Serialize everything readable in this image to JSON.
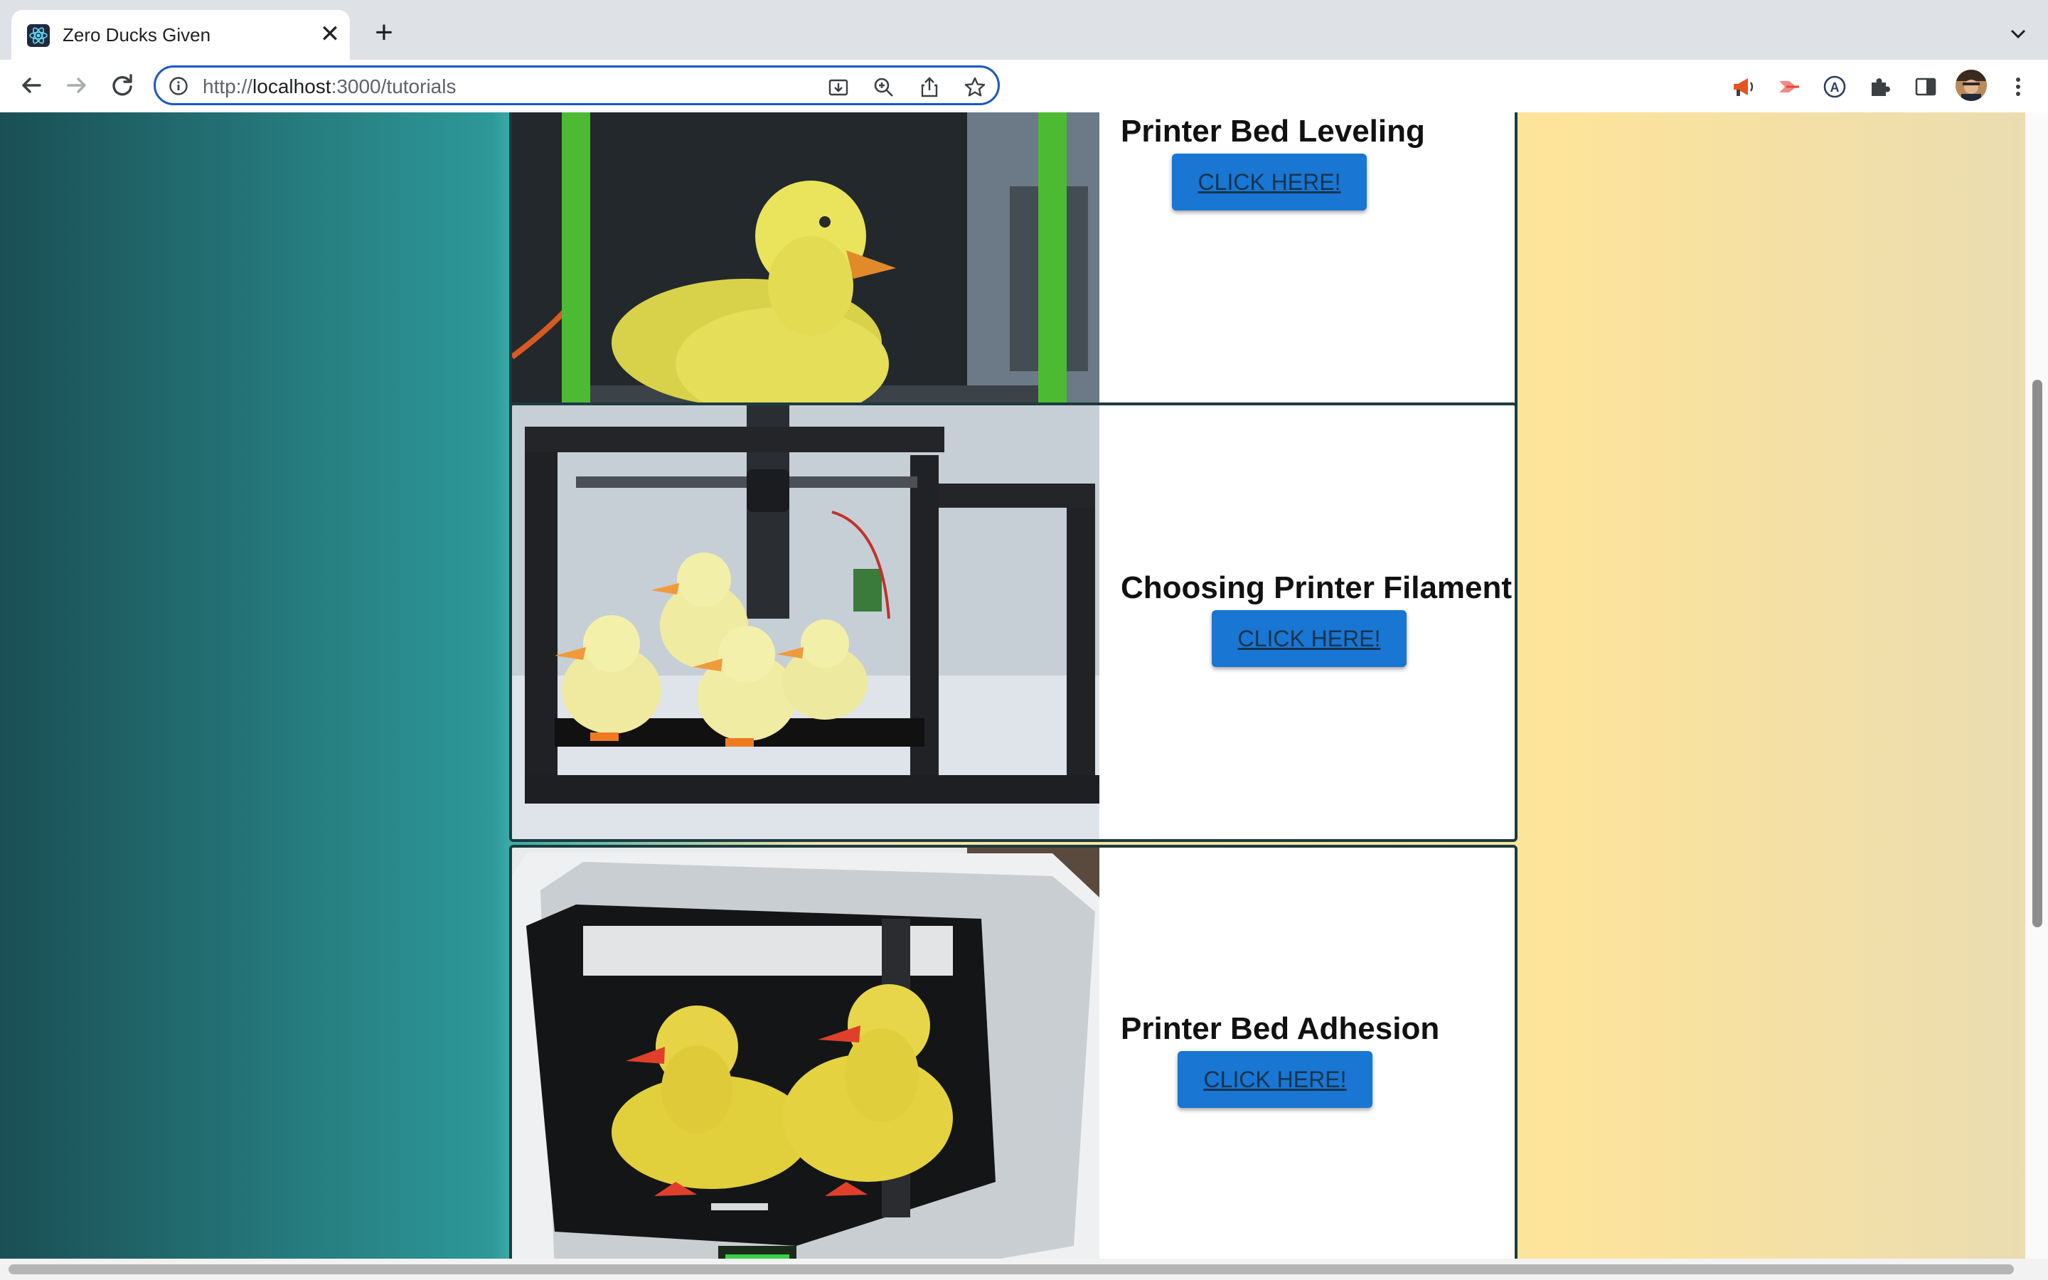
{
  "browser": {
    "tab_title": "Zero Ducks Given",
    "url_scheme": "http://",
    "url_host": "localhost",
    "url_path": ":3000/tutorials",
    "icons": {
      "favicon": "react-atom-icon",
      "tab_close": "close-icon",
      "new_tab": "plus-icon",
      "back": "back-arrow-icon",
      "forward": "forward-arrow-icon",
      "reload": "reload-icon",
      "site_info": "info-icon",
      "install": "install-app-icon",
      "zoom": "zoom-icon",
      "share": "share-icon",
      "bookmark": "star-icon",
      "extension_1": "megaphone-icon",
      "extension_2": "arrow-extension-icon",
      "extension_3": "circled-a-icon",
      "extensions": "puzzle-icon",
      "side_panel": "side-panel-icon",
      "menu": "kebab-menu-icon"
    },
    "close_glyph": "✕",
    "new_tab_glyph": "+"
  },
  "tutorials": [
    {
      "title": "Printer Bed Leveling",
      "button_label": "CLICK HERE!",
      "image": "yellow duck print in green printer"
    },
    {
      "title": "Choosing Printer Filament",
      "button_label": "CLICK HERE!",
      "image": "row of yellow ducks in black printer"
    },
    {
      "title": "Printer Bed Adhesion",
      "button_label": "CLICK HERE!",
      "image": "two yellow ducks in white printer"
    }
  ],
  "colors": {
    "button": "#1976d2",
    "card_border": "#1d3b3f",
    "omnibox_focus": "#1a57c6"
  }
}
